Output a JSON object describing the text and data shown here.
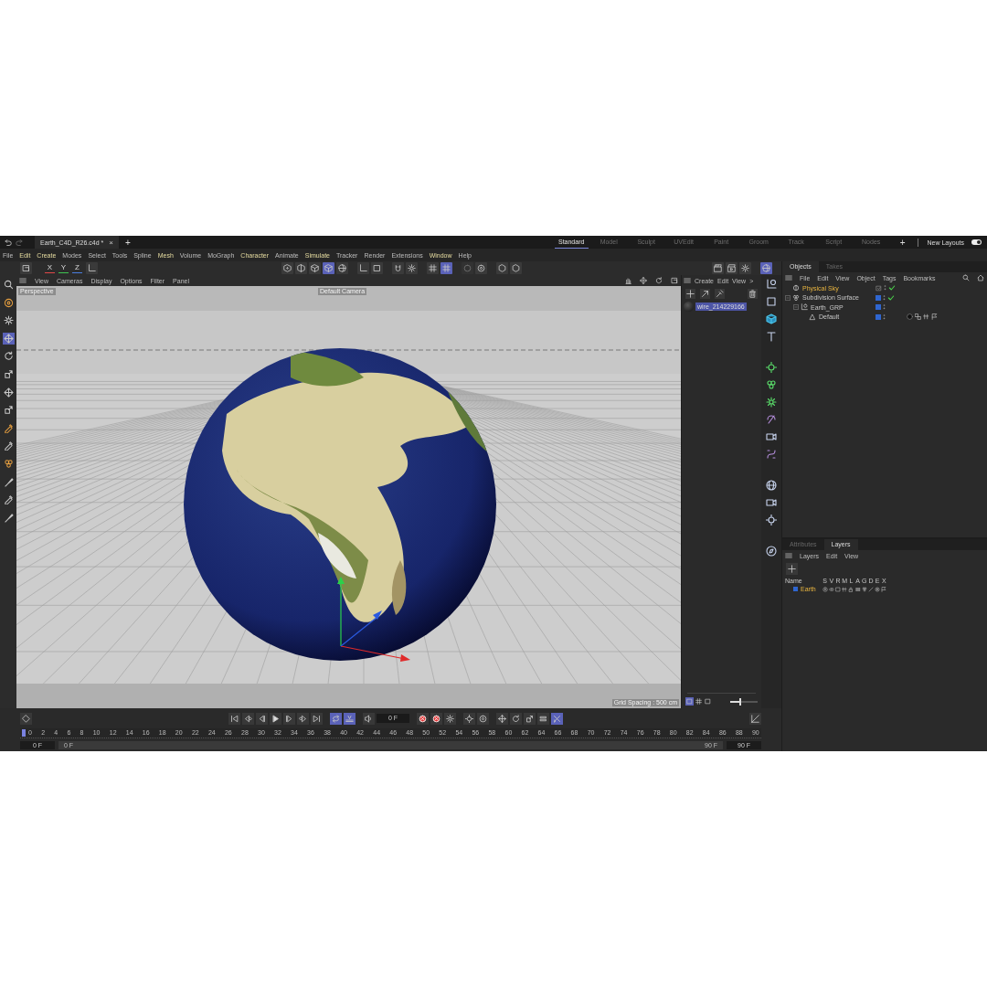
{
  "title_bar": {
    "file_tab": {
      "title": "Earth_C4D_R26.c4d *",
      "close": "×"
    },
    "new_tab": "+",
    "layouts": [
      {
        "label": "Standard",
        "selected": true
      },
      {
        "label": "Model",
        "selected": false
      },
      {
        "label": "Sculpt",
        "selected": false
      },
      {
        "label": "UVEdit",
        "selected": false
      },
      {
        "label": "Paint",
        "selected": false
      },
      {
        "label": "Groom",
        "selected": false
      },
      {
        "label": "Track",
        "selected": false
      },
      {
        "label": "Script",
        "selected": false
      },
      {
        "label": "Nodes",
        "selected": false
      }
    ],
    "add_layout": "+",
    "new_layouts": {
      "label": "New Layouts",
      "on": true
    }
  },
  "menu_bar": [
    {
      "label": "File",
      "accent": false
    },
    {
      "label": "Edit",
      "accent": true
    },
    {
      "label": "Create",
      "accent": true
    },
    {
      "label": "Modes",
      "accent": false
    },
    {
      "label": "Select",
      "accent": false
    },
    {
      "label": "Tools",
      "accent": false
    },
    {
      "label": "Spline",
      "accent": false
    },
    {
      "label": "Mesh",
      "accent": true
    },
    {
      "label": "Volume",
      "accent": false
    },
    {
      "label": "MoGraph",
      "accent": false
    },
    {
      "label": "Character",
      "accent": true
    },
    {
      "label": "Animate",
      "accent": false
    },
    {
      "label": "Simulate",
      "accent": true
    },
    {
      "label": "Tracker",
      "accent": false
    },
    {
      "label": "Render",
      "accent": false
    },
    {
      "label": "Extensions",
      "accent": false
    },
    {
      "label": "Window",
      "accent": true
    },
    {
      "label": "Help",
      "accent": false
    }
  ],
  "toolbar": {
    "axis_locks": [
      "X",
      "Y",
      "Z"
    ],
    "buttons": [
      {
        "selected": false
      },
      {
        "selected": false
      },
      {
        "selected": false
      },
      {
        "selected": true
      },
      {
        "selected": false
      },
      {
        "selected": false
      },
      {
        "selected": false
      },
      {
        "selected": false
      },
      {
        "selected": false
      },
      {
        "selected": false
      },
      {
        "selected": true
      },
      {
        "selected": false
      },
      {
        "selected": false
      },
      {
        "selected": false
      },
      {
        "selected": false
      },
      {
        "selected": false
      },
      {
        "selected": false
      },
      {
        "selected": false
      },
      {
        "selected": true
      }
    ]
  },
  "left_tools": [
    {
      "selected": false
    },
    {
      "selected": false
    },
    {
      "selected": false
    },
    {
      "selected": true
    },
    {
      "selected": false
    },
    {
      "selected": false
    },
    {
      "selected": false
    },
    {
      "selected": false
    },
    {
      "selected": false
    },
    {
      "selected": false
    },
    {
      "selected": false
    },
    {
      "selected": false
    },
    {
      "selected": false
    },
    {
      "selected": false
    }
  ],
  "viewport": {
    "menu": [
      "View",
      "Cameras",
      "Display",
      "Options",
      "Filter",
      "Panel"
    ],
    "view_name": "Perspective",
    "camera": "Default Camera",
    "grid_spacing": "Grid Spacing : 500 cm"
  },
  "asset_browser": {
    "menu": [
      "Create",
      "Edit",
      "View"
    ],
    "more": ">",
    "items": [
      {
        "name": "wire_214229166",
        "selected": true
      }
    ],
    "view_modes": [
      {
        "selected": true
      },
      {
        "selected": false
      },
      {
        "selected": false
      }
    ],
    "zoom": {
      "level": 0.35
    }
  },
  "objects_panel": {
    "tabs": [
      {
        "label": "Objects",
        "selected": true
      },
      {
        "label": "Takes",
        "selected": false
      }
    ],
    "menu": [
      "File",
      "Edit",
      "View",
      "Object",
      "Tags",
      "Bookmarks"
    ],
    "tree": [
      {
        "name": "Physical Sky",
        "selected": true,
        "checked": true,
        "layer": false,
        "tags": false
      },
      {
        "name": "Subdivision Surface",
        "selected": false,
        "checked": true,
        "layer": true,
        "tags": false,
        "expanded": true,
        "children": [
          {
            "name": "Earth_GRP",
            "selected": false,
            "checked": false,
            "layer": true,
            "tags": false,
            "expanded": true,
            "children": [
              {
                "name": "Default",
                "selected": false,
                "checked": false,
                "layer": true,
                "tags": true
              }
            ]
          }
        ]
      }
    ]
  },
  "layers_panel": {
    "tabs": [
      {
        "label": "Attributes",
        "selected": false
      },
      {
        "label": "Layers",
        "selected": true
      }
    ],
    "menu": [
      "Layers",
      "Edit",
      "View"
    ],
    "columns": [
      "Name",
      "S",
      "V",
      "R",
      "M",
      "L",
      "A",
      "G",
      "D",
      "E",
      "X"
    ],
    "rows": [
      {
        "name": "Earth",
        "color": "#2f66d0",
        "selected": true
      }
    ]
  },
  "timeline": {
    "current_frame": "0 F",
    "controls": [
      {
        "selected": false
      },
      {
        "selected": false
      },
      {
        "selected": false
      },
      {
        "selected": false
      },
      {
        "selected": false
      },
      {
        "selected": false
      },
      {
        "selected": false
      },
      {
        "selected": true
      },
      {
        "selected": true
      },
      {
        "selected": false
      },
      {
        "selected": false
      },
      {
        "selected": false
      },
      {
        "selected": false
      },
      {
        "selected": false
      },
      {
        "selected": false
      },
      {
        "selected": false
      },
      {
        "selected": false
      },
      {
        "selected": false
      },
      {
        "selected": false
      },
      {
        "selected": true
      }
    ],
    "ruler": [
      "0",
      "2",
      "4",
      "6",
      "8",
      "10",
      "12",
      "14",
      "16",
      "18",
      "20",
      "22",
      "24",
      "26",
      "28",
      "30",
      "32",
      "34",
      "36",
      "38",
      "40",
      "42",
      "44",
      "46",
      "48",
      "50",
      "52",
      "54",
      "56",
      "58",
      "60",
      "62",
      "64",
      "66",
      "68",
      "70",
      "72",
      "74",
      "76",
      "78",
      "80",
      "82",
      "84",
      "86",
      "88",
      "90"
    ],
    "playhead": {
      "level": 0
    },
    "range_bar": {
      "level": 1
    },
    "start": "0 F",
    "range_start": "0 F",
    "range_end": "90 F",
    "end": "90 F"
  }
}
